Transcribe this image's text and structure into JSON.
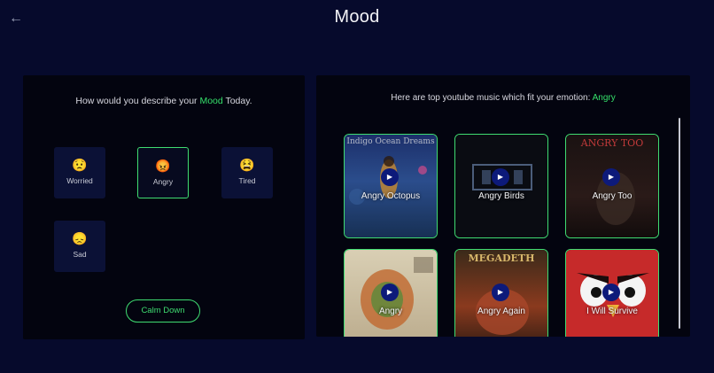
{
  "header": {
    "title": "Mood",
    "back_icon": "arrow-left-icon"
  },
  "left_panel": {
    "question_prefix": "How would you describe your ",
    "question_highlight": "Mood",
    "question_suffix": " Today.",
    "moods": [
      {
        "label": "Worried",
        "emoji": "😟",
        "selected": false
      },
      {
        "label": "Angry",
        "emoji": "😡",
        "selected": true
      },
      {
        "label": "Tired",
        "emoji": "😫",
        "selected": false
      },
      {
        "label": "Sad",
        "emoji": "😞",
        "selected": false
      }
    ],
    "calm_button": "Calm Down"
  },
  "right_panel": {
    "heading_prefix": "Here are top youtube music which fit your emotion: ",
    "heading_emotion": "Angry",
    "songs": [
      {
        "title": "Angry Octopus",
        "thumb_text": "Indigo Ocean Dreams"
      },
      {
        "title": "Angry Birds",
        "thumb_text": ""
      },
      {
        "title": "Angry Too",
        "thumb_text": "ANGRY TOO"
      },
      {
        "title": "Angry",
        "thumb_text": ""
      },
      {
        "title": "Angry Again",
        "thumb_text": "MEGADETH"
      },
      {
        "title": "I Will Survive",
        "thumb_text": ""
      }
    ]
  },
  "colors": {
    "accent": "#3fdc71",
    "background": "#060a2c",
    "panel": "#03040f",
    "play": "#0d1a7a"
  }
}
